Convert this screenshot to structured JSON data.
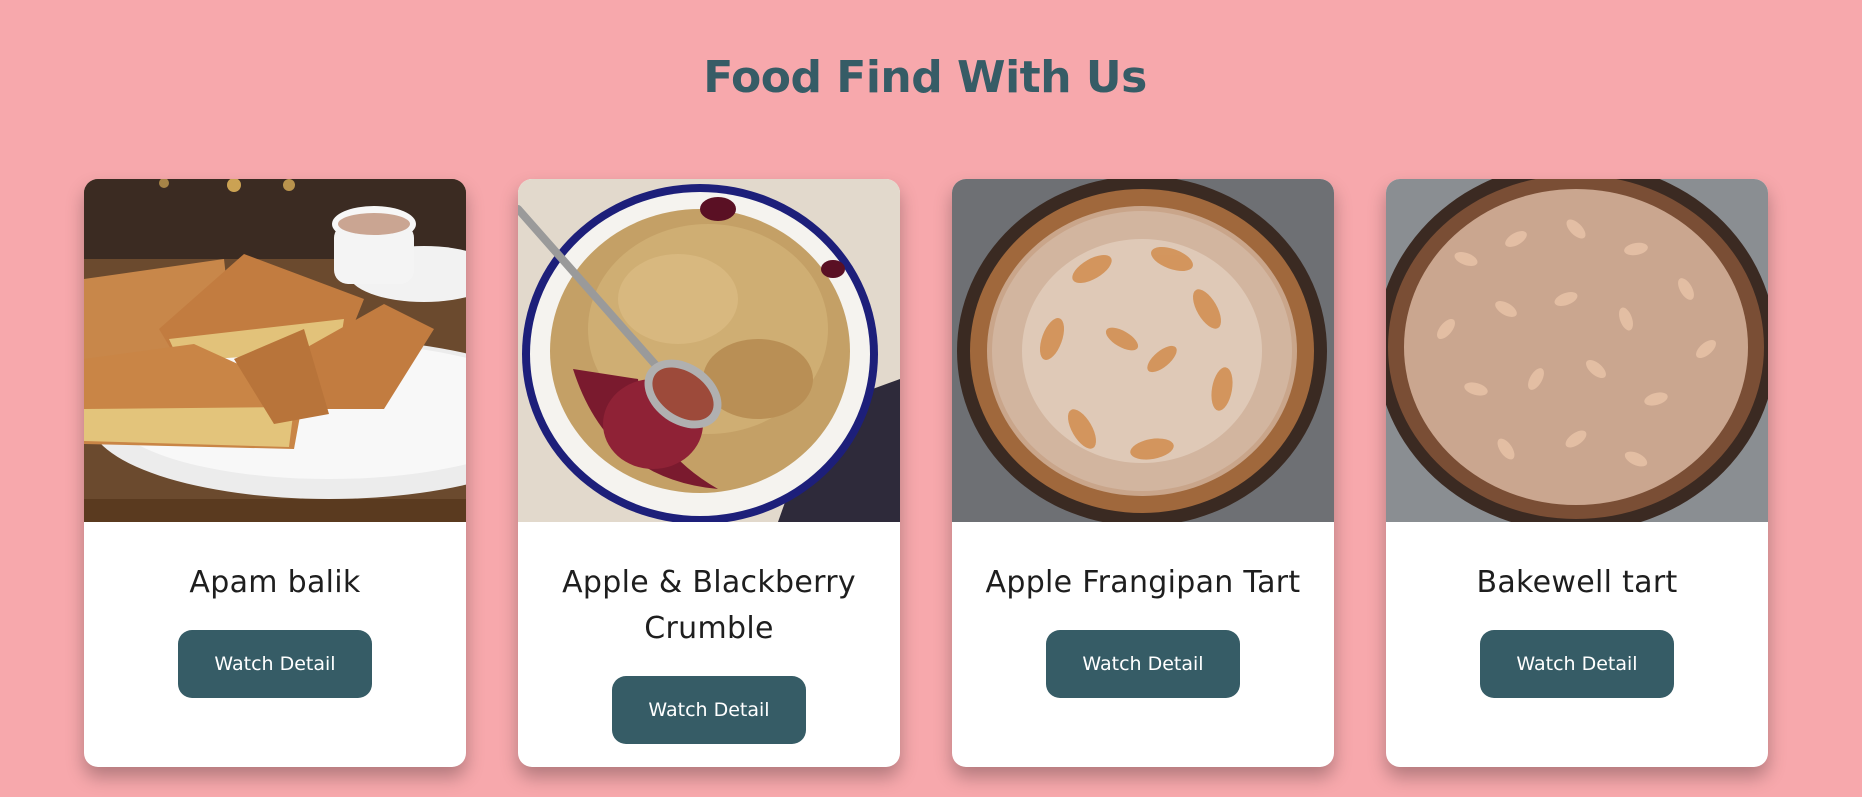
{
  "header": {
    "title": "Food Find With Us"
  },
  "cards": [
    {
      "title": "Apam balik",
      "button_label": "Watch Detail",
      "image_alt": "Apam balik"
    },
    {
      "title": "Apple & Blackberry Crumble",
      "button_label": "Watch Detail",
      "image_alt": "Apple & Blackberry Crumble"
    },
    {
      "title": "Apple Frangipan Tart",
      "button_label": "Watch Detail",
      "image_alt": "Apple Frangipan Tart"
    },
    {
      "title": "Bakewell tart",
      "button_label": "Watch Detail",
      "image_alt": "Bakewell tart"
    }
  ],
  "colors": {
    "background": "#f7a8ac",
    "title": "#365c66",
    "button": "#365c66",
    "card": "#ffffff"
  }
}
